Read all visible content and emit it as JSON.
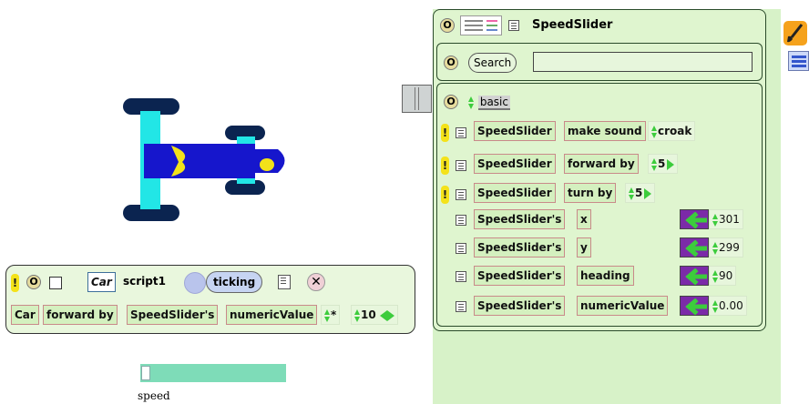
{
  "viewer": {
    "title": "SpeedSlider",
    "search_label": "Search",
    "search_value": "",
    "category": "basic",
    "object": "SpeedSlider",
    "possessive": "SpeedSlider's",
    "commands": [
      {
        "verb": "make sound",
        "arg": "croak",
        "has_arrow": false
      },
      {
        "verb": "forward by",
        "arg": "5",
        "has_arrow": true
      },
      {
        "verb": "turn by",
        "arg": "5",
        "has_arrow": true
      }
    ],
    "slots": [
      {
        "name": "x",
        "value": "301"
      },
      {
        "name": "y",
        "value": "299"
      },
      {
        "name": "heading",
        "value": "90"
      },
      {
        "name": "numericValue",
        "value": "0.00"
      }
    ]
  },
  "script": {
    "object": "Car",
    "name": "script1",
    "status": "ticking",
    "body_object": "Car",
    "body_verb": "forward by",
    "body_source": "SpeedSlider's",
    "body_attr": "numericValue",
    "operator": "*",
    "operand": "10"
  },
  "slider": {
    "label": "speed",
    "value": 0.0,
    "track_color": "#7edcb8"
  },
  "colors": {
    "viewer_bg": "#d7f2c8",
    "viewer_border": "#2a4a2a",
    "tile_bg": "#d4f0bf",
    "assign_arrow": "#7b2aa8",
    "car_body": "#1616cc",
    "car_wheels": "#0b2450",
    "car_axles": "#22e6e6",
    "car_accent": "#f2e21a"
  }
}
